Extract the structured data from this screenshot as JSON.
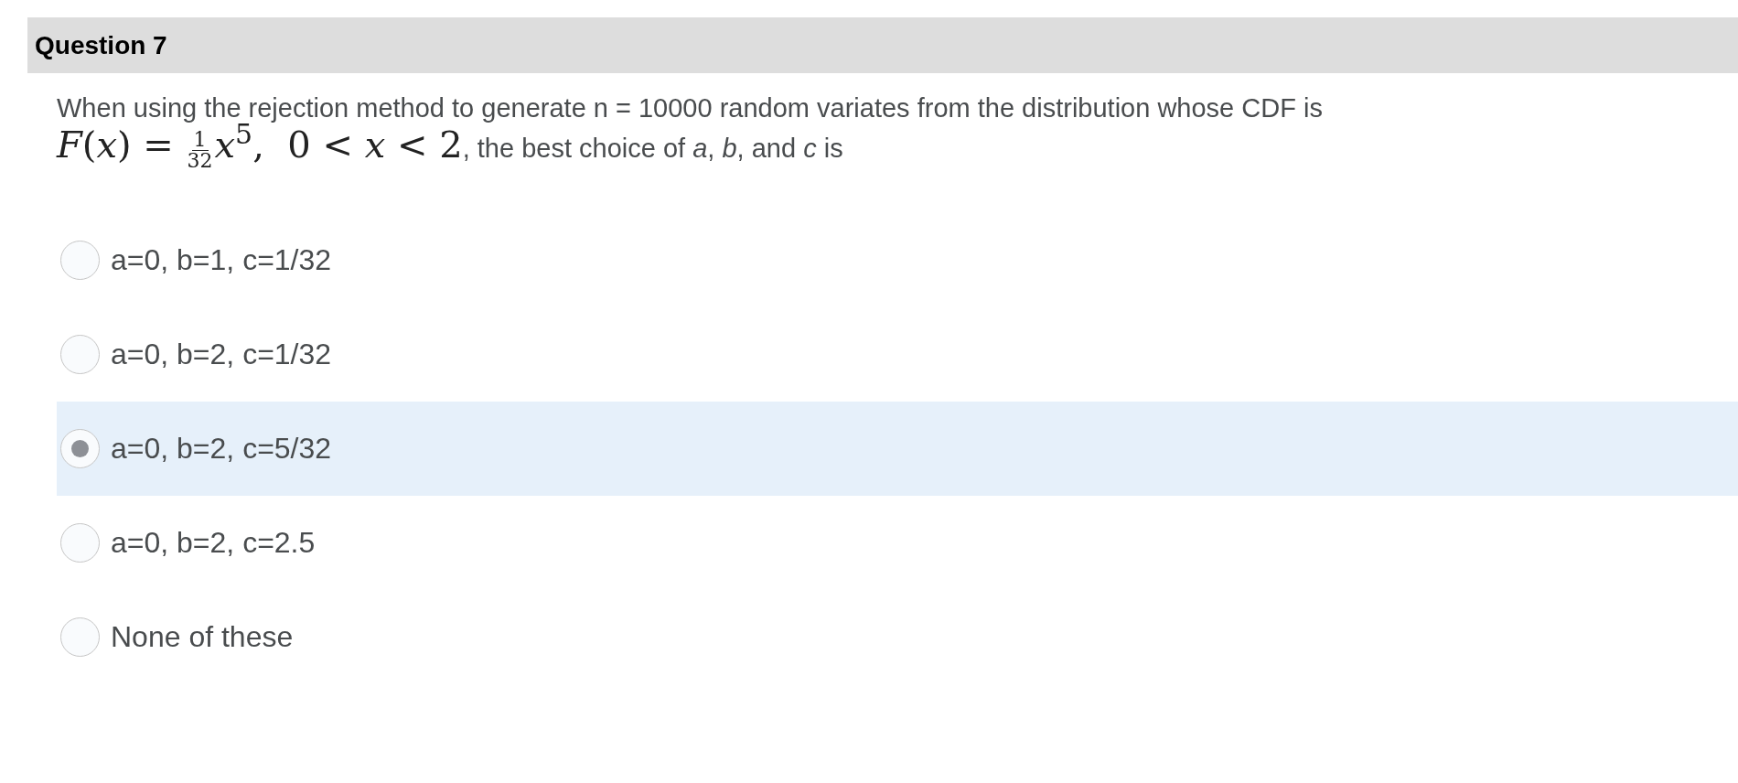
{
  "question": {
    "title": "Question 7",
    "text_before": "When using the rejection method to generate n = 10000 random variates from the distribution whose CDF is",
    "formula_lhs": "*F*(*x*) =",
    "formula_numerator": "1",
    "formula_denominator": "32",
    "formula_rhs": "*x*$^{5}$,  0 < *x* < 2",
    "text_after": ", the best choice of *a*, *b*, and *c* is"
  },
  "options": [
    {
      "label": "a=0, b=1, c=1/32",
      "selected": false
    },
    {
      "label": "a=0, b=2, c=1/32",
      "selected": false
    },
    {
      "label": "a=0, b=2, c=5/32",
      "selected": true
    },
    {
      "label": "a=0, b=2, c=2.5",
      "selected": false
    },
    {
      "label": "None of these",
      "selected": false
    }
  ]
}
